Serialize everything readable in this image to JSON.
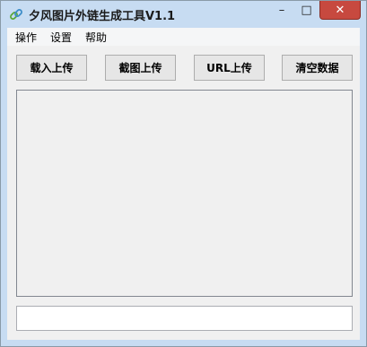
{
  "window": {
    "title": "夕风图片外链生成工具V1.1",
    "minimize_glyph": "–",
    "maximize_glyph": "□",
    "close_glyph": "✕",
    "accent_color": "#c7dcf2",
    "close_color": "#c7493f"
  },
  "icons": {
    "app": "link-icon",
    "minimize": "minimize-icon",
    "maximize": "maximize-icon",
    "close": "close-icon"
  },
  "menu": {
    "items": [
      {
        "label": "操作"
      },
      {
        "label": "设置"
      },
      {
        "label": "帮助"
      }
    ]
  },
  "toolbar": {
    "load_upload": "载入上传",
    "screenshot_upload": "截图上传",
    "url_upload": "URL上传",
    "clear_data": "清空数据"
  },
  "output": {
    "url_value": "",
    "url_placeholder": ""
  }
}
